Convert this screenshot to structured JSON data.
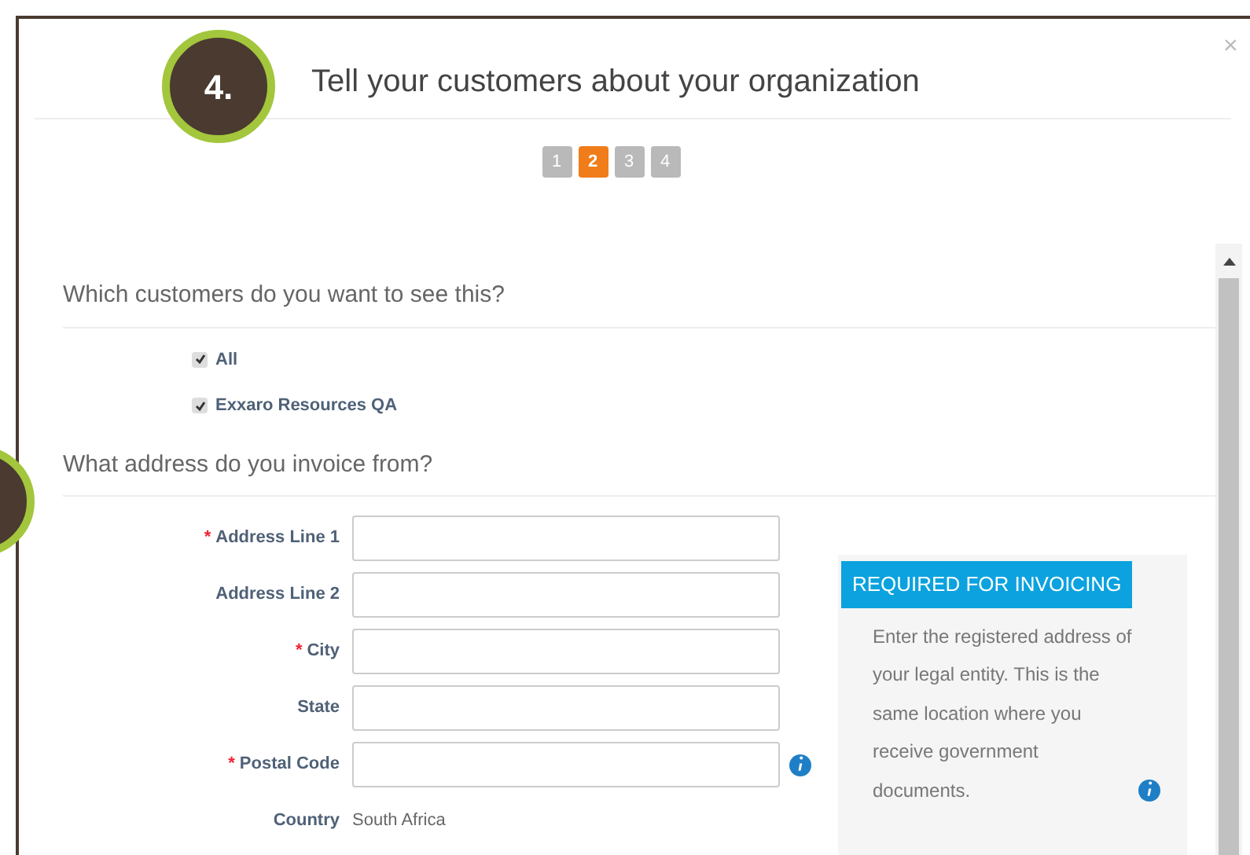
{
  "annotations": [
    {
      "kind": "numbered",
      "label": "4."
    },
    {
      "kind": "partial"
    }
  ],
  "dialog": {
    "title": "Tell your customers about your organization",
    "close": "×"
  },
  "steps": [
    {
      "label": "1",
      "selected": false
    },
    {
      "label": "2",
      "selected": true
    },
    {
      "label": "3",
      "selected": false
    },
    {
      "label": "4",
      "selected": false
    }
  ],
  "sections": [
    {
      "heading": "Which customers do you want to see this?",
      "checkboxes": [
        {
          "label": "All",
          "checked": true
        },
        {
          "label": "Exxaro Resources QA",
          "checked": true
        }
      ]
    },
    {
      "heading": "What address do you invoice from?"
    }
  ],
  "address_fields": [
    {
      "kind": "input",
      "label": "Address Line 1",
      "required_mark": "*"
    },
    {
      "kind": "input",
      "label": "Address Line 2"
    },
    {
      "kind": "input",
      "label": "City",
      "required_mark": "*"
    },
    {
      "kind": "input",
      "label": "State"
    },
    {
      "kind": "input",
      "label": "Postal Code",
      "required_mark": "*",
      "info": true
    },
    {
      "kind": "static",
      "label": "Country",
      "value": "South Africa"
    }
  ],
  "info_panel": {
    "title": "REQUIRED FOR INVOICING",
    "text": "Enter the registered address of your legal entity. This is the same location where you receive government documents."
  }
}
